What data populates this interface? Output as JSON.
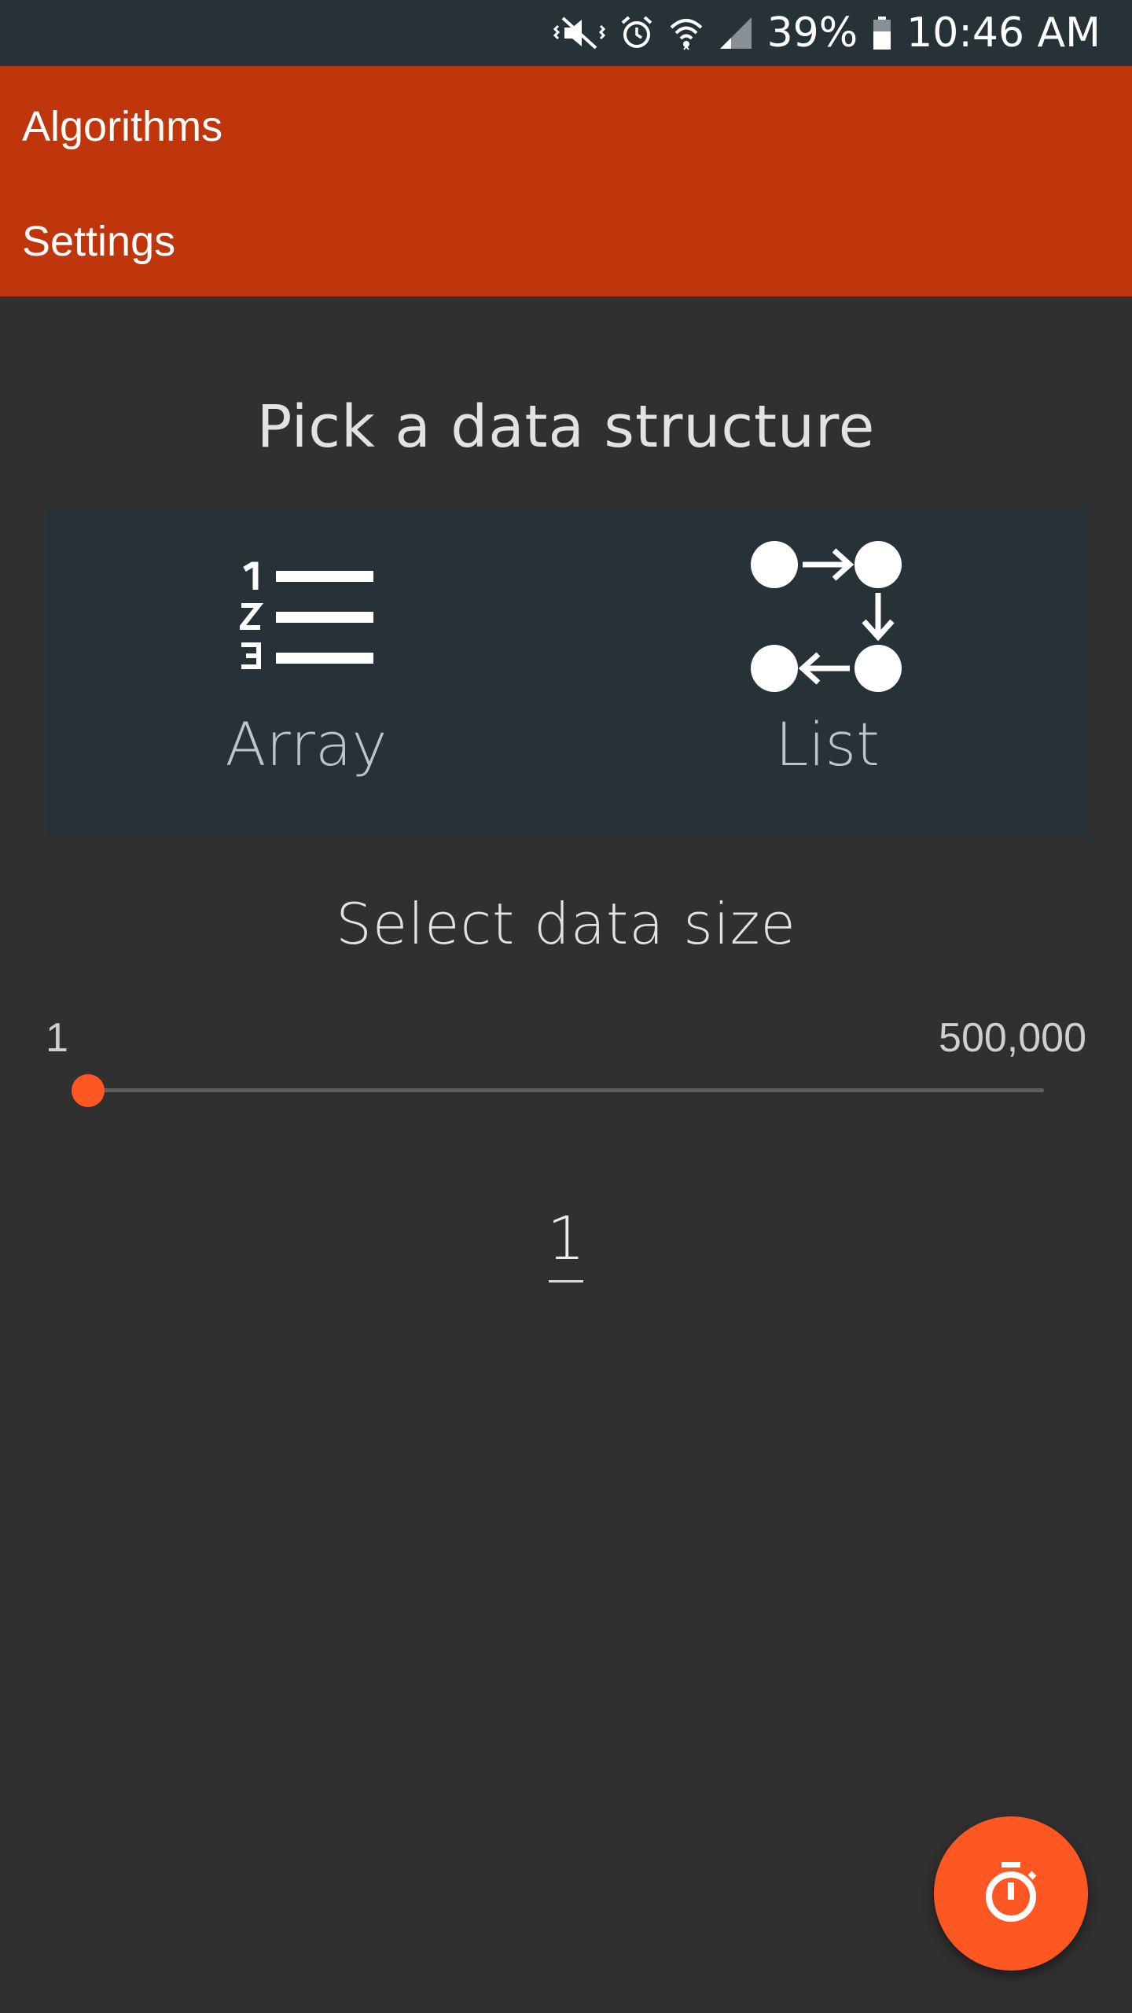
{
  "status_bar": {
    "battery": "39%",
    "time": "10:46 AM",
    "icons": [
      "mute-vibrate-icon",
      "alarm-icon",
      "wifi-icon",
      "signal-icon",
      "battery-icon"
    ]
  },
  "menu": {
    "items": [
      {
        "label": "Algorithms"
      },
      {
        "label": "Settings"
      }
    ]
  },
  "main": {
    "pick_title": "Pick a data structure",
    "data_structures": [
      {
        "label": "Array",
        "icon": "numbered-list-icon"
      },
      {
        "label": "List",
        "icon": "linked-list-icon"
      }
    ],
    "size_title": "Select data size",
    "slider": {
      "min_label": "1",
      "max_label": "500,000",
      "value_fraction": 0.0
    },
    "value": "1"
  },
  "fab": {
    "icon": "stopwatch-icon"
  },
  "colors": {
    "status_bar": "#263238",
    "header": "#bf360c",
    "background": "#303030",
    "card": "#263238",
    "accent": "#ff5722"
  }
}
